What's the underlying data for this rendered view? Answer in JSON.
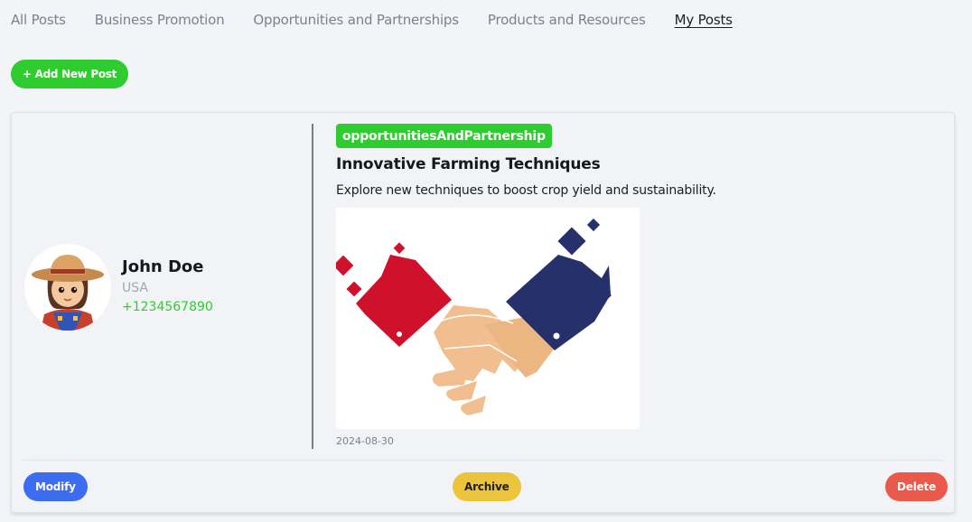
{
  "tabs": [
    {
      "label": "All Posts",
      "active": false
    },
    {
      "label": "Business Promotion",
      "active": false
    },
    {
      "label": "Opportunities and Partnerships",
      "active": false
    },
    {
      "label": "Products and Resources",
      "active": false
    },
    {
      "label": "My Posts",
      "active": true
    }
  ],
  "add_post_label": "+ Add New Post",
  "post": {
    "user": {
      "name": "John Doe",
      "country": "USA",
      "phone": "+1234567890"
    },
    "category": "opportunitiesAndPartnership",
    "title": "Innovative Farming Techniques",
    "description": "Explore new techniques to boost crop yield and sustainability.",
    "date": "2024-08-30",
    "image_icon": "handshake-image"
  },
  "actions": {
    "modify": "Modify",
    "archive": "Archive",
    "delete": "Delete"
  },
  "colors": {
    "accent_green": "#2ecc2e",
    "modify_blue": "#3c6cf0",
    "archive_yellow": "#ecc43c",
    "delete_red": "#ea5a4a"
  }
}
